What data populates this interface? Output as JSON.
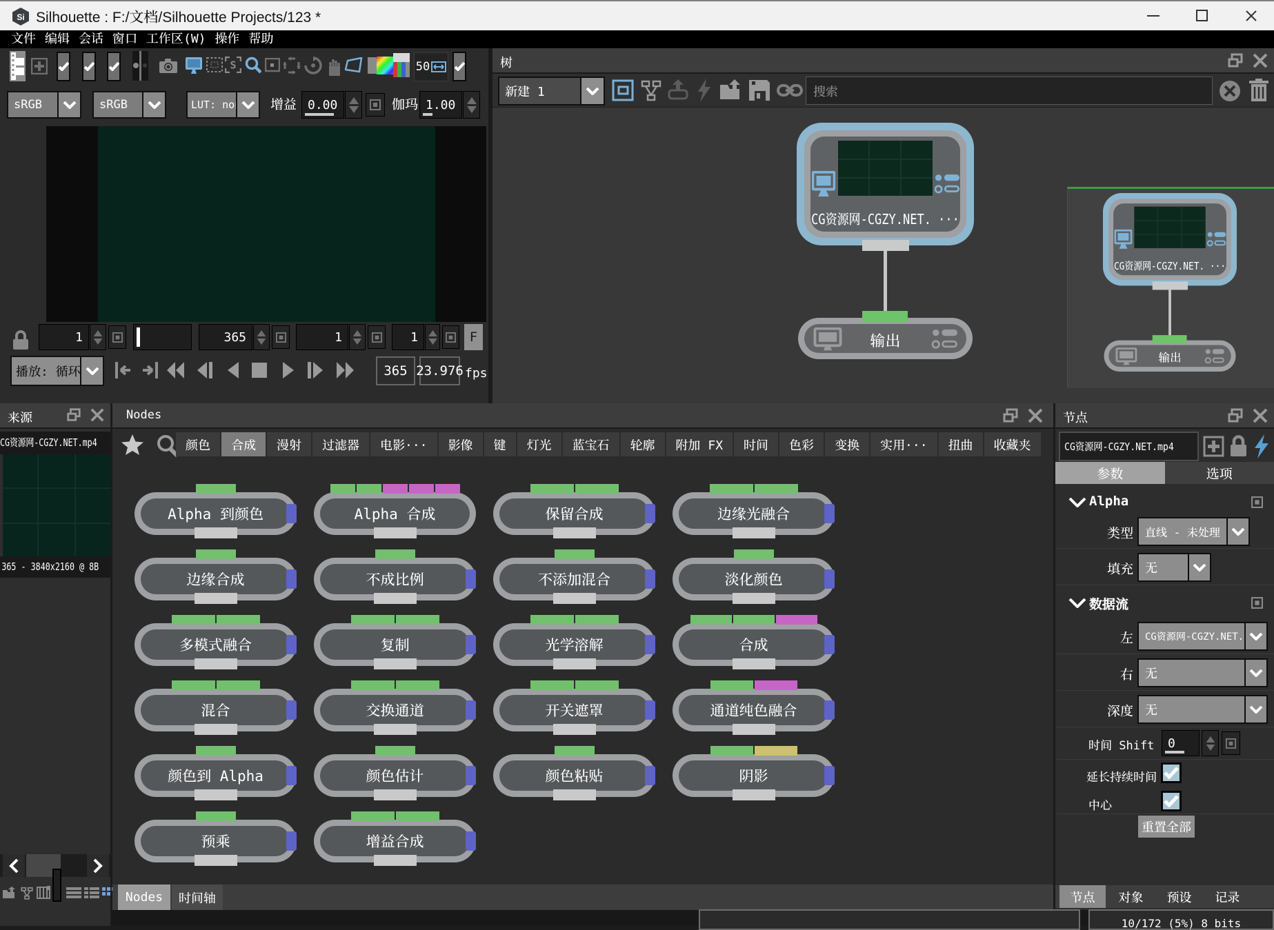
{
  "window": {
    "title": "Silhouette : F:/文档/Silhouette Projects/123 *",
    "logo": "Si"
  },
  "menu": {
    "items": [
      "文件",
      "编辑",
      "会话",
      "窗口",
      "工作区(W)",
      "操作",
      "帮助"
    ]
  },
  "toolbar": {
    "colorspace_left": "sRGB",
    "colorspace_right": "sRGB",
    "lut": "LUT: non",
    "gain_label": "增益",
    "gain_value": "0.00",
    "gamma_label": "伽玛",
    "gamma_value": "1.00",
    "zoom_value": "50"
  },
  "viewer": {
    "frame_start": "1",
    "range_end": "365",
    "field_c": "1",
    "field_d": "1",
    "f_button": "F",
    "play_mode": "播放: 循环",
    "total_frames": "365",
    "fps_value": "23.976",
    "fps_label": "fps"
  },
  "tree": {
    "panel_title": "树",
    "session_name": "新建 1",
    "search_placeholder": "搜索",
    "source_node_label": "CG资源网-CGZY.NET. ···",
    "output_node_label": "输出"
  },
  "source": {
    "panel_title": "来源",
    "clip_name": "CG资源网-CGZY.NET.mp4",
    "clip_info": "365 - 3840x2160 @ 8B"
  },
  "nodes": {
    "panel_title": "Nodes",
    "tabs": [
      "颜色",
      "合成",
      "漫射",
      "过滤器",
      "电影···",
      "影像",
      "键",
      "灯光",
      "蓝宝石",
      "轮廓",
      "附加 FX",
      "时间",
      "色彩",
      "变换",
      "实用···",
      "扭曲",
      "收藏夹"
    ],
    "active_tab": "合成",
    "items": [
      {
        "label": "Alpha 到颜色",
        "ports": [
          "green"
        ],
        "pw": 58,
        "blue": true
      },
      {
        "label": "Alpha 合成",
        "ports": [
          "green",
          "green",
          "magenta",
          "magenta",
          "magenta"
        ],
        "pw": 36,
        "blue": false
      },
      {
        "label": "保留合成",
        "ports": [
          "green",
          "green"
        ],
        "pw": 63,
        "blue": true
      },
      {
        "label": "边缘光融合",
        "ports": [
          "green",
          "green"
        ],
        "pw": 63,
        "blue": true
      },
      {
        "label": "边缘合成",
        "ports": [
          "green"
        ],
        "pw": 58,
        "blue": true
      },
      {
        "label": "不成比例",
        "ports": [
          "green"
        ],
        "pw": 58,
        "blue": true
      },
      {
        "label": "不添加混合",
        "ports": [
          "green"
        ],
        "pw": 58,
        "blue": true
      },
      {
        "label": "淡化颜色",
        "ports": [
          "green"
        ],
        "pw": 58,
        "blue": true
      },
      {
        "label": "多模式融合",
        "ports": [
          "green",
          "green"
        ],
        "pw": 63,
        "blue": true
      },
      {
        "label": "复制",
        "ports": [
          "green",
          "green"
        ],
        "pw": 63,
        "blue": true
      },
      {
        "label": "光学溶解",
        "ports": [
          "green",
          "green"
        ],
        "pw": 63,
        "blue": true
      },
      {
        "label": "合成",
        "ports": [
          "green",
          "green",
          "magenta"
        ],
        "pw": 60,
        "blue": true
      },
      {
        "label": "混合",
        "ports": [
          "green",
          "green"
        ],
        "pw": 63,
        "blue": true
      },
      {
        "label": "交换通道",
        "ports": [
          "green",
          "green"
        ],
        "pw": 63,
        "blue": true
      },
      {
        "label": "开关遮罩",
        "ports": [
          "green",
          "green"
        ],
        "pw": 63,
        "blue": true
      },
      {
        "label": "通道纯色融合",
        "ports": [
          "green",
          "magenta"
        ],
        "pw": 62,
        "blue": true
      },
      {
        "label": "颜色到 Alpha",
        "ports": [
          "green"
        ],
        "pw": 58,
        "blue": true
      },
      {
        "label": "颜色估计",
        "ports": [
          "green"
        ],
        "pw": 58,
        "blue": true
      },
      {
        "label": "颜色粘贴",
        "ports": [
          "green"
        ],
        "pw": 58,
        "blue": true
      },
      {
        "label": "阴影",
        "ports": [
          "green",
          "yellow"
        ],
        "pw": 62,
        "blue": true
      },
      {
        "label": "预乘",
        "ports": [
          "green"
        ],
        "pw": 58,
        "blue": true
      },
      {
        "label": "增益合成",
        "ports": [
          "green",
          "green"
        ],
        "pw": 63,
        "blue": true
      }
    ],
    "bottom_tabs": [
      "Nodes",
      "时间轴"
    ],
    "bottom_active": "Nodes"
  },
  "params": {
    "panel_title": "节点",
    "node_name": "CG资源网-CGZY.NET.mp4",
    "tabs": [
      "参数",
      "选项"
    ],
    "active_tab": "参数",
    "alpha_section": "Alpha",
    "type_label": "类型",
    "type_value": "直线 - 未处理",
    "fill_label": "填充",
    "fill_value": "无",
    "stream_section": "数据流",
    "left_label": "左",
    "left_value": "CG资源网-CGZY.NET.",
    "right_label": "右",
    "right_value": "无",
    "depth_label": "深度",
    "depth_value": "无",
    "shift_label": "时间 Shift",
    "shift_value": "0",
    "extend_label": "延长持续时间",
    "extend_checked": true,
    "center_label": "中心",
    "center_checked": true,
    "reset_label": "重置全部",
    "bottom_tabs": [
      "节点",
      "对象",
      "预设",
      "记录"
    ],
    "bottom_active": "节点",
    "status": "10/172 (5%) 8 bits"
  },
  "colors": {
    "port_green": "#72c06e",
    "port_magenta": "#c765c7",
    "port_yellow": "#cdc26a",
    "port_output_blue": "#5e63c8",
    "selection_blue": "#8db7cf",
    "accent_blue": "#5a9fd4"
  }
}
